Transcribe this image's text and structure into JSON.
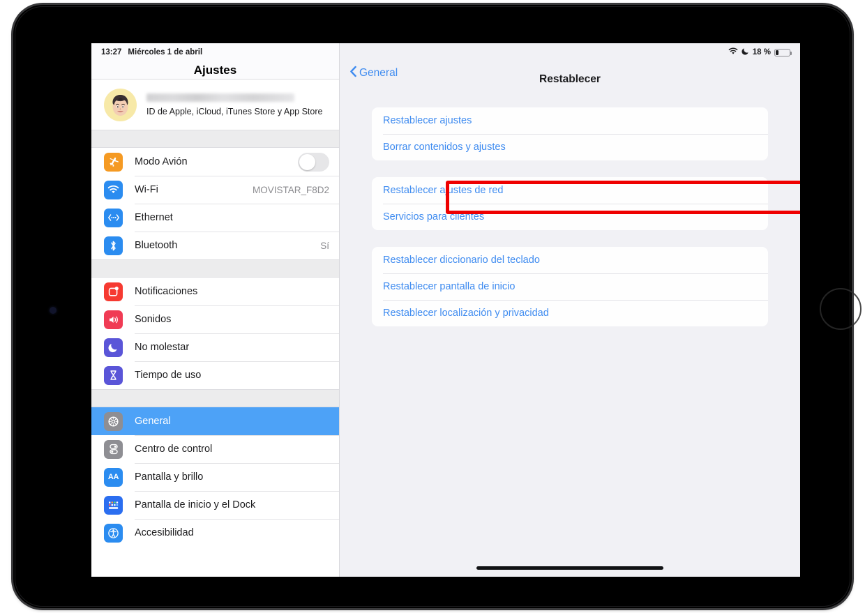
{
  "status_bar": {
    "time": "13:27",
    "date": "Miércoles 1 de abril",
    "wifi_icon": "wifi-icon",
    "dnd_icon": "moon-icon",
    "battery_percent": "18 %",
    "battery_icon": "battery-icon"
  },
  "sidebar": {
    "title": "Ajustes",
    "account": {
      "avatar_icon": "memoji-avatar",
      "name": "",
      "subtitle": "ID de Apple, iCloud, iTunes Store y App Store"
    },
    "groups": [
      {
        "items": [
          {
            "label": "Modo Avión",
            "icon": "airplane-icon",
            "icon_color": "#f59a23",
            "control": "toggle",
            "toggle_on": false
          },
          {
            "label": "Wi-Fi",
            "icon": "wifi-icon",
            "icon_color": "#2b8cf0",
            "value": "MOVISTAR_F8D2"
          },
          {
            "label": "Ethernet",
            "icon": "ethernet-icon",
            "icon_color": "#2b8cf0",
            "value": ""
          },
          {
            "label": "Bluetooth",
            "icon": "bluetooth-icon",
            "icon_color": "#2b8cf0",
            "value": "Sí"
          }
        ]
      },
      {
        "items": [
          {
            "label": "Notificaciones",
            "icon": "notifications-icon",
            "icon_color": "#f63a31",
            "value": ""
          },
          {
            "label": "Sonidos",
            "icon": "speaker-icon",
            "icon_color": "#f03b54",
            "value": ""
          },
          {
            "label": "No molestar",
            "icon": "moon-icon",
            "icon_color": "#5a55d8",
            "value": ""
          },
          {
            "label": "Tiempo de uso",
            "icon": "hourglass-icon",
            "icon_color": "#5a55d8",
            "value": ""
          }
        ]
      },
      {
        "items": [
          {
            "label": "General",
            "icon": "gear-icon",
            "icon_color": "#8e8e93",
            "value": "",
            "selected": true
          },
          {
            "label": "Centro de control",
            "icon": "control-center-icon",
            "icon_color": "#8e8e93",
            "value": ""
          },
          {
            "label": "Pantalla y brillo",
            "icon": "display-brightness-icon",
            "icon_color": "#2b8cf0",
            "value": ""
          },
          {
            "label": "Pantalla de inicio y el Dock",
            "icon": "home-screen-dock-icon",
            "icon_color": "#2b6ef0",
            "value": ""
          },
          {
            "label": "Accesibilidad",
            "icon": "accessibility-icon",
            "icon_color": "#2b8cf0",
            "value": ""
          }
        ]
      }
    ]
  },
  "detail": {
    "back_label": "General",
    "back_icon": "chevron-left-icon",
    "title": "Restablecer",
    "groups": [
      {
        "items": [
          {
            "label": "Restablecer ajustes",
            "highlighted": false
          },
          {
            "label": "Borrar contenidos y ajustes",
            "highlighted": true
          }
        ]
      },
      {
        "items": [
          {
            "label": "Restablecer ajustes de red",
            "highlighted": false
          },
          {
            "label": "Servicios para clientes",
            "highlighted": false
          }
        ]
      },
      {
        "items": [
          {
            "label": "Restablecer diccionario del teclado",
            "highlighted": false
          },
          {
            "label": "Restablecer pantalla de inicio",
            "highlighted": false
          },
          {
            "label": "Restablecer localización y privacidad",
            "highlighted": false
          }
        ]
      }
    ]
  },
  "annotation": {
    "highlight_color": "#ef0000",
    "target_label": "Borrar contenidos y ajustes"
  },
  "theme": {
    "accent_blue": "#3e8bf0",
    "selection_blue": "#4da2f7",
    "pane_background": "#f1f1f5",
    "card_background": "#fefefe"
  }
}
